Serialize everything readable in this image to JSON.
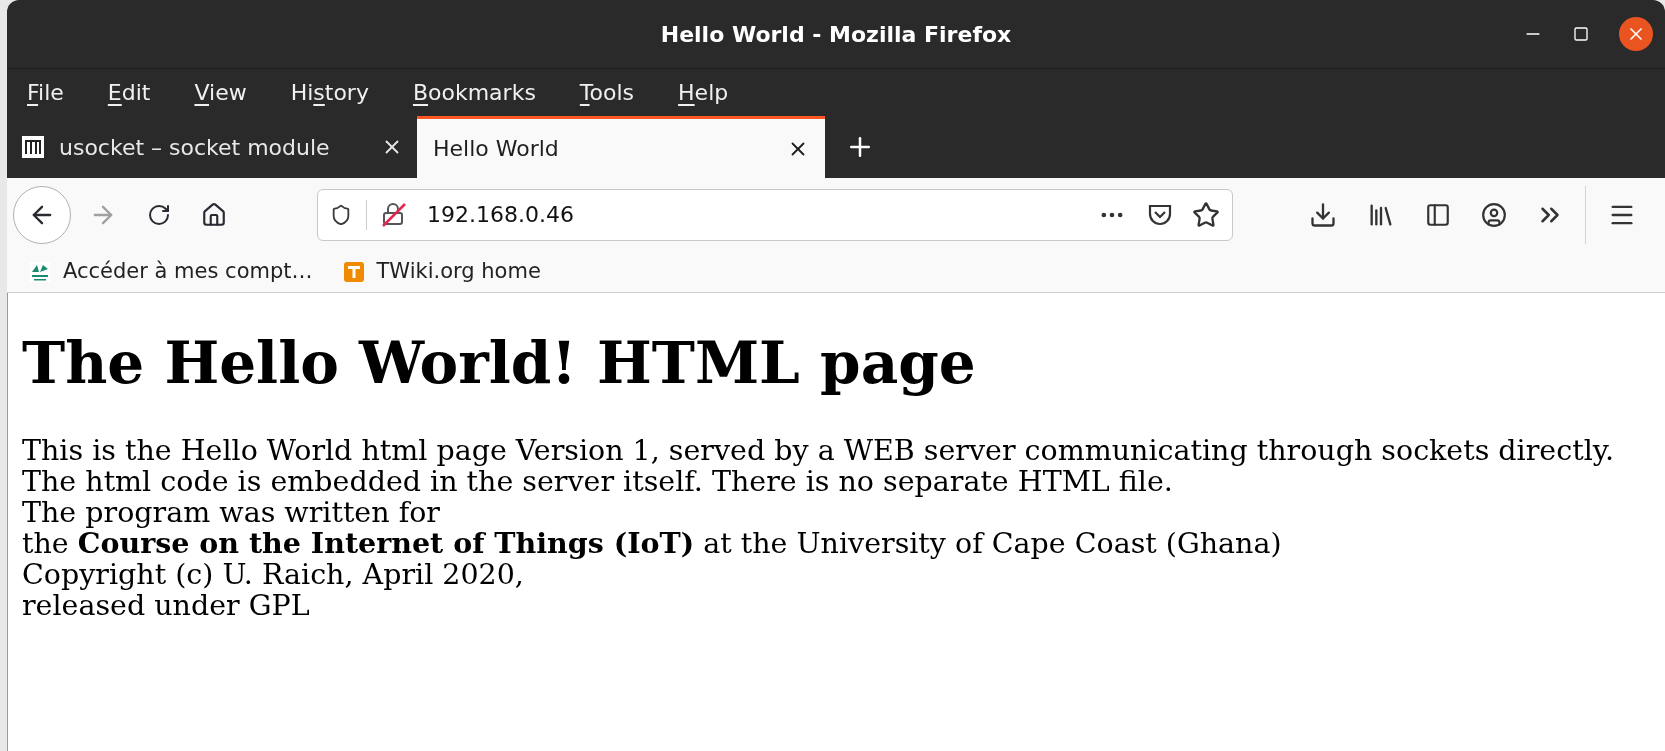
{
  "window": {
    "title": "Hello World - Mozilla Firefox"
  },
  "menu": [
    {
      "key": "F",
      "after": "ile"
    },
    {
      "key": "E",
      "after": "dit"
    },
    {
      "key": "V",
      "after": "iew"
    },
    {
      "before": "Hi",
      "key": "s",
      "after": "tory"
    },
    {
      "key": "B",
      "after": "ookmarks"
    },
    {
      "key": "T",
      "after": "ools"
    },
    {
      "key": "H",
      "after": "elp"
    }
  ],
  "tabs": [
    {
      "title": "usocket – socket module",
      "selected": false
    },
    {
      "title": "Hello World",
      "selected": true
    }
  ],
  "address_bar": {
    "value": "192.168.0.46"
  },
  "bookmarks": [
    {
      "label": "Accéder à mes compt…",
      "kind": "bank"
    },
    {
      "label": "TWiki.org home",
      "kind": "twiki"
    }
  ],
  "page": {
    "heading": "The Hello World! HTML page",
    "lines": [
      "This is the Hello World html page Version 1, served by a WEB server communicating through sockets directly.",
      "The html code is embedded in the server itself. There is no separate HTML file.",
      "The program was written for",
      "the **Course on the Internet of Things (IoT)** at the University of Cape Coast (Ghana)",
      "Copyright (c) U. Raich, April 2020,",
      "released under GPL"
    ]
  }
}
